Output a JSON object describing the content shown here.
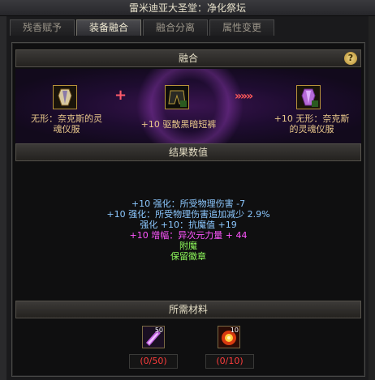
{
  "window": {
    "title": "雷米迪亚大圣堂：净化祭坛"
  },
  "tabs": [
    {
      "label": "残香赋予",
      "active": false
    },
    {
      "label": "装备融合",
      "active": true
    },
    {
      "label": "融合分离",
      "active": false
    },
    {
      "label": "属性变更",
      "active": false
    }
  ],
  "fusion": {
    "header": "融合",
    "help": "?",
    "source_item": {
      "label_line1": "无形：奈克斯的灵",
      "label_line2": "魂仪服",
      "icon": "purple-armor-icon"
    },
    "material_item": {
      "label": "+10 驱散黑暗短裤",
      "icon": "dark-shorts-icon"
    },
    "result_item": {
      "label_line1": "+10 无形：奈克斯",
      "label_line2": "的灵魂仪服",
      "icon": "purple-armor-icon"
    },
    "plus": "+",
    "arrows": "»»»"
  },
  "result": {
    "header": "结果数值",
    "lines": [
      {
        "text": "+10 强化：所受物理伤害 -7",
        "color": "blue"
      },
      {
        "text": "+10 强化：所受物理伤害追加减少 2.9%",
        "color": "blue"
      },
      {
        "text": "强化 +10：抗魔值 +19",
        "color": "blue"
      },
      {
        "text": "+10 增幅：异次元力量 + 44",
        "color": "magenta"
      },
      {
        "text": "附魔",
        "color": "green"
      },
      {
        "text": "保留徽章",
        "color": "green"
      }
    ]
  },
  "materials": {
    "header": "所需材料",
    "items": [
      {
        "icon": "purple-crystal-icon",
        "badge": "50",
        "qty": "(0/50)"
      },
      {
        "icon": "fire-orb-icon",
        "badge": "10",
        "qty": "(0/10)"
      }
    ]
  },
  "colors": {
    "blue": "#8cc8ff",
    "magenta": "#ff56ff",
    "green": "#8ffb5c",
    "qty_red": "#ff3c3c"
  }
}
